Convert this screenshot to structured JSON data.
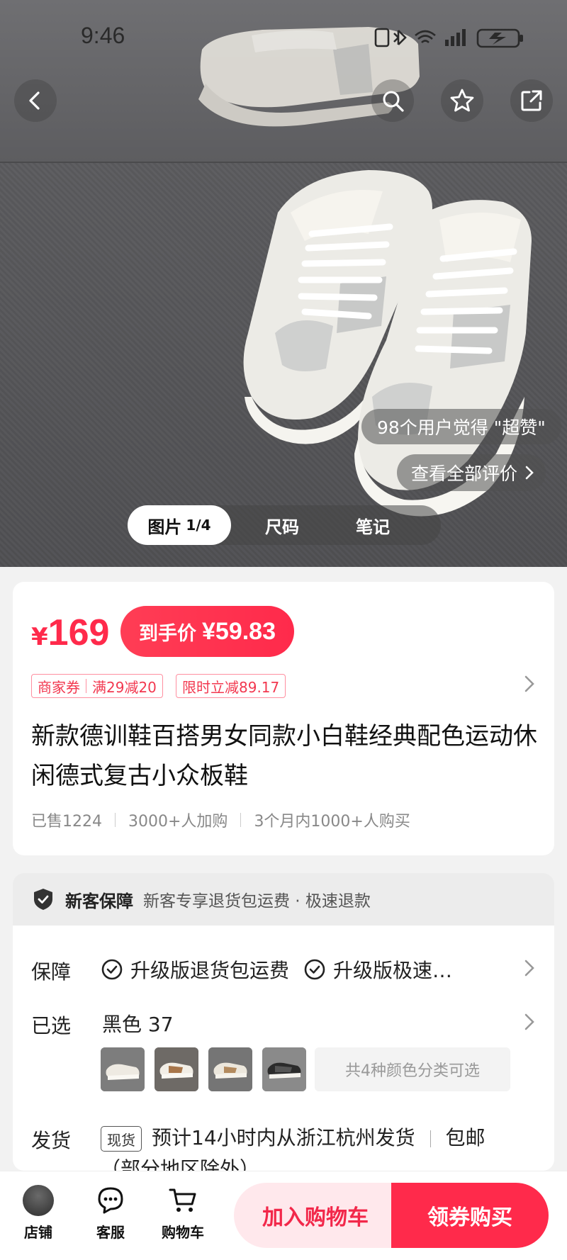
{
  "status_bar": {
    "time": "9:46"
  },
  "hero": {
    "praise_text": "98个用户觉得 \"超赞\"",
    "all_reviews_label": "查看全部评价",
    "media_tabs": [
      {
        "label": "图片",
        "counter": "1/4"
      },
      {
        "label": "尺码"
      },
      {
        "label": "笔记"
      }
    ]
  },
  "price_card": {
    "currency": "¥",
    "price": "169",
    "final_price_label": "到手价",
    "final_price": "¥59.83",
    "coupons": [
      {
        "label": "商家券",
        "detail": "满29减20"
      },
      {
        "label": "限时立减89.17"
      }
    ],
    "title": "新款德训鞋百搭男女同款小白鞋经典配色运动休闲德式复古小众板鞋",
    "stats": [
      "已售1224",
      "3000+人加购",
      "3个月内1000+人购买"
    ]
  },
  "service": {
    "new_customer_title": "新客保障",
    "new_customer_desc": "新客专享退货包运费 · 极速退款",
    "guarantee_label": "保障",
    "guarantees": [
      "升级版退货包运费",
      "升级版极速…"
    ],
    "selected_label": "已选",
    "selected_value": "黑色 37",
    "variants_note": "共4种颜色分类可选",
    "shipping_label": "发货",
    "shipping_tag": "现货",
    "shipping_text": "预计14小时内从浙江杭州发货",
    "shipping_free": "包邮",
    "shipping_note": "（部分地区除外）"
  },
  "bottom_bar": {
    "shop_label": "店铺",
    "service_label": "客服",
    "cart_label": "购物车",
    "add_to_cart": "加入购物车",
    "buy_with_coupon": "领券购买"
  },
  "colors": {
    "accent": "#ff2a4b",
    "accent_light": "#ffe8ec"
  }
}
